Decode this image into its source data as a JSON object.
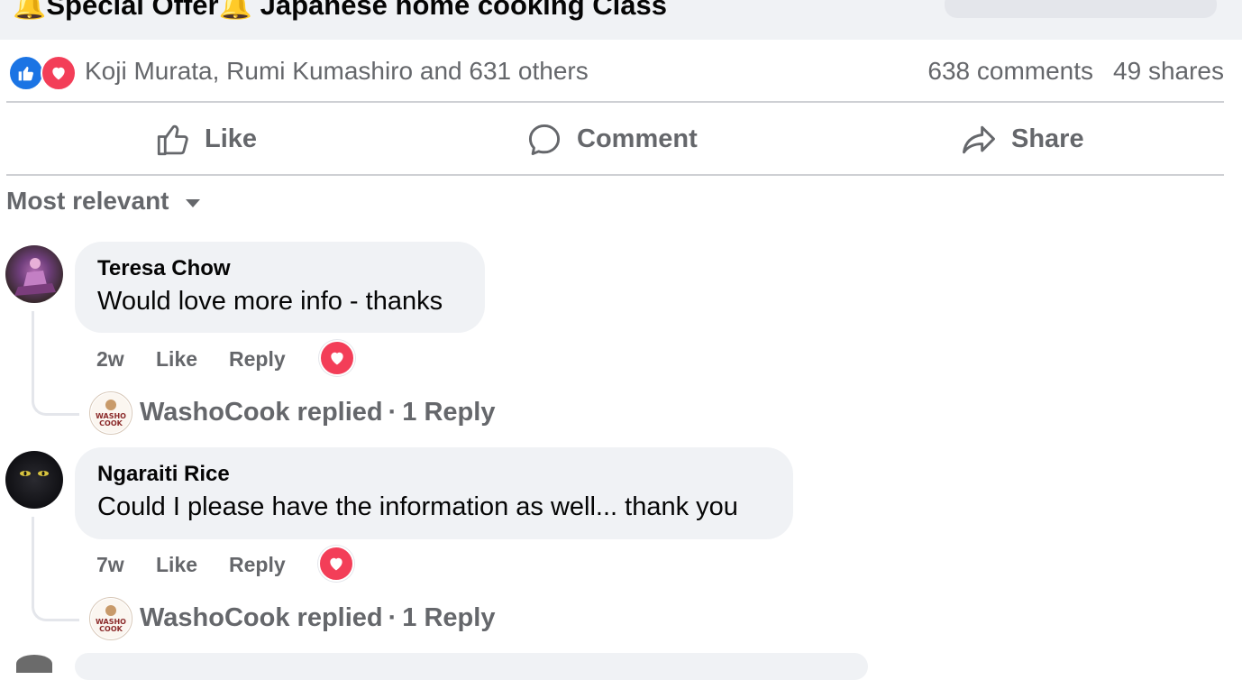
{
  "post": {
    "title": "Special Offer",
    "title_rest": "Japanese home cooking Class",
    "title_emoji": "🔔"
  },
  "reactions": {
    "reactors": "Koji Murata, Rumi Kumashiro and 631 others",
    "comments": "638 comments",
    "shares": "49 shares"
  },
  "actions": {
    "like": "Like",
    "comment": "Comment",
    "share": "Share"
  },
  "sort": {
    "label": "Most relevant"
  },
  "comments": [
    {
      "author": "Teresa Chow",
      "text": "Would love more info - thanks",
      "time": "2w",
      "like": "Like",
      "reply": "Reply",
      "replied_by": "WashoCook replied",
      "reply_count": "1 Reply"
    },
    {
      "author": "Ngaraiti Rice",
      "text": "Could I please have the information as well... thank you",
      "time": "7w",
      "like": "Like",
      "reply": "Reply",
      "replied_by": "WashoCook replied",
      "reply_count": "1 Reply"
    }
  ],
  "colors": {
    "like_blue": "#1b74e4",
    "love_red": "#f33e58",
    "secondary_text": "#65676b",
    "bubble_bg": "#f0f2f5"
  },
  "logo_text": "WASHO COOK"
}
